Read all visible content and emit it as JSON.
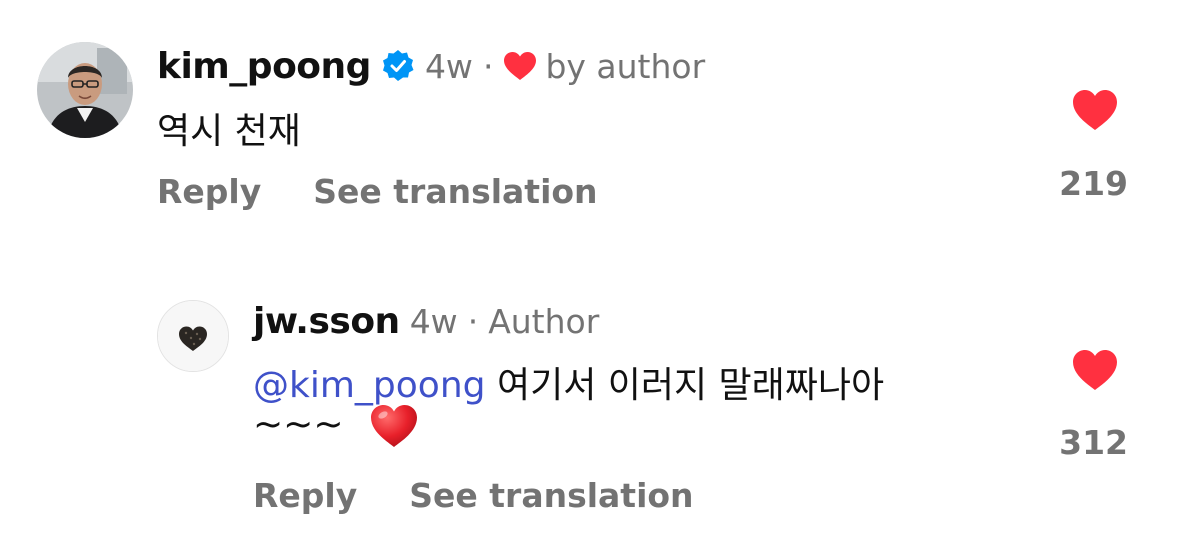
{
  "comments": [
    {
      "username": "kim_poong",
      "verified": true,
      "time": "4w",
      "separator": "·",
      "liked_by_author_label": "by author",
      "text": "역시 천재",
      "actions": {
        "reply": "Reply",
        "translate": "See translation"
      },
      "likes": "219",
      "heart_color": "#ff3040"
    }
  ],
  "replies": [
    {
      "username": "jw.sson",
      "time": "4w",
      "separator": "·",
      "author_badge": "Author",
      "mention": "@kim_poong",
      "text_line1": "여기서 이러지 말래짜나아",
      "text_line2": "~~~",
      "emoji": "red-heart-emoji",
      "actions": {
        "reply": "Reply",
        "translate": "See translation"
      },
      "likes": "312",
      "heart_color": "#ff3040"
    }
  ],
  "colors": {
    "verified_badge": "#0095f6",
    "mention": "#3f51c9",
    "secondary_text": "#737373"
  }
}
